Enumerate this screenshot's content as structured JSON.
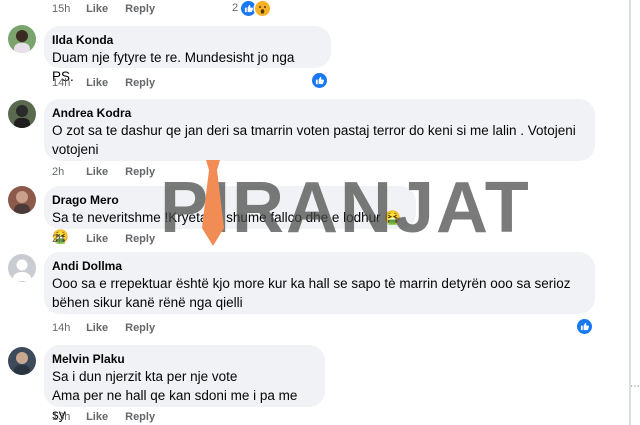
{
  "labels": {
    "like": "Like",
    "reply": "Reply"
  },
  "watermark": "PIRANJAT",
  "top_row": {
    "time": "15h",
    "reaction_count": "2"
  },
  "comments": [
    {
      "author": "Ilda Konda",
      "text": "Duam nje fytyre te re. Mundesisht jo nga PS.",
      "time": "14h",
      "avatar_color": "#7aa36e",
      "reaction": "like"
    },
    {
      "author": "Andrea Kodra",
      "text": "O zot sa te dashur qe jan deri sa tmarrin voten pastaj terror do keni si me lalin . Votojeni\nvotojeni",
      "time": "2h",
      "avatar_color": "#5a6a4e",
      "reaction": ""
    },
    {
      "author": "Drago Mero",
      "text": "Sa te neveritshme !Kryetarja shume fallco dhe e lodhur 🤮🤮",
      "time": "2h",
      "avatar_color": "#8b5a4a",
      "reaction": ""
    },
    {
      "author": "Andi Dollma",
      "text": "Ooo sa e rrepektuar është kjo more kur ka hall se sapo tè marrin detyrën ooo sa serioz\nbëhen sikur kanë rënë nga qielli",
      "time": "14h",
      "avatar_color": "#c9ccd1",
      "reaction": "like"
    },
    {
      "author": "Melvin Plaku",
      "text": "Sa i dun njerzit kta per nje vote\nAma per ne hall qe kan sdoni me i pa me sy",
      "time": "13h",
      "avatar_color": "#3d4a5a",
      "reaction": ""
    }
  ],
  "colors": {
    "accent": "#1877f2",
    "bubble": "#f0f2f5",
    "meta": "#65676b",
    "tie": "#f28c55"
  }
}
